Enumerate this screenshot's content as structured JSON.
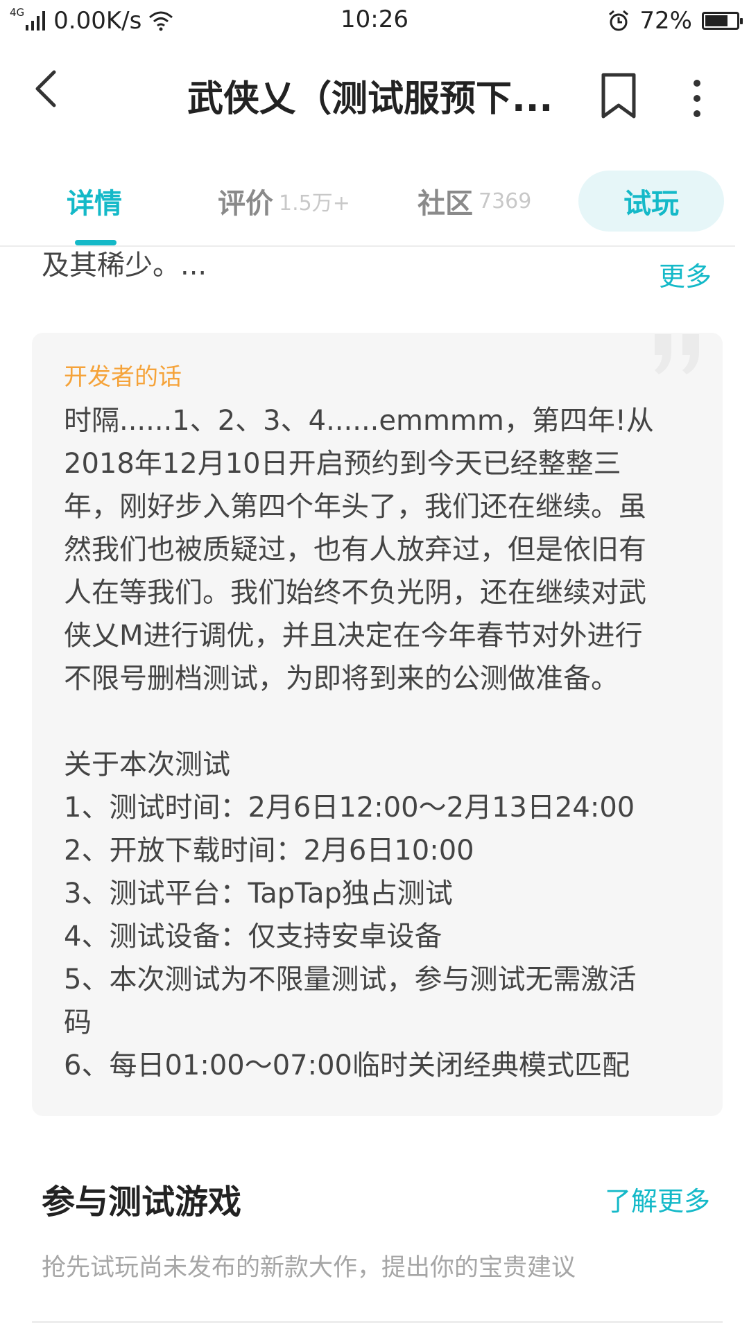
{
  "status_bar": {
    "network_type": "4G",
    "net_speed": "0.00K/s",
    "time": "10:26",
    "battery_percent": "72%",
    "battery_level": 0.72
  },
  "header": {
    "title": "武侠乂（测试服预下...",
    "icons": [
      "back-icon",
      "bookmark-icon",
      "more-vertical-icon"
    ]
  },
  "tabs": [
    {
      "label": "详情",
      "count": ""
    },
    {
      "label": "评价",
      "count": "1.5万+"
    },
    {
      "label": "社区",
      "count": "7369"
    },
    {
      "label": "试玩",
      "count": ""
    }
  ],
  "active_tab": "详情",
  "description": {
    "tail_text": "及其稀少。...",
    "more_label": "更多"
  },
  "developer_note": {
    "title": "开发者的话",
    "lines": [
      "时隔......1、2、3、4......emmmm，第四年!从",
      "2018年12月10日开启预约到今天已经整整三",
      "年，刚好步入第四个年头了，我们还在继续。虽",
      "然我们也被质疑过，也有人放弃过，但是依旧有",
      "人在等我们。我们始终不负光阴，还在继续对武",
      "侠乂M进行调优，并且决定在今年春节对外进行",
      "不限号删档测试，为即将到来的公测做准备。",
      "",
      "关于本次测试",
      "1、测试时间：2月6日12:00～2月13日24:00",
      "2、开放下载时间：2月6日10:00",
      "3、测试平台：TapTap独占测试",
      "4、测试设备：仅支持安卓设备",
      "5、本次测试为不限量测试，参与测试无需激活",
      "码",
      "6、每日01:00～07:00临时关闭经典模式匹配"
    ]
  },
  "beta_section": {
    "title": "参与测试游戏",
    "learn_more_label": "了解更多",
    "subtitle": "抢先试玩尚未发布的新款大作，提出你的宝贵建议"
  },
  "colors": {
    "accent": "#14b9c8",
    "dev_title": "#f5a33a",
    "card_bg": "#f6f6f6"
  }
}
